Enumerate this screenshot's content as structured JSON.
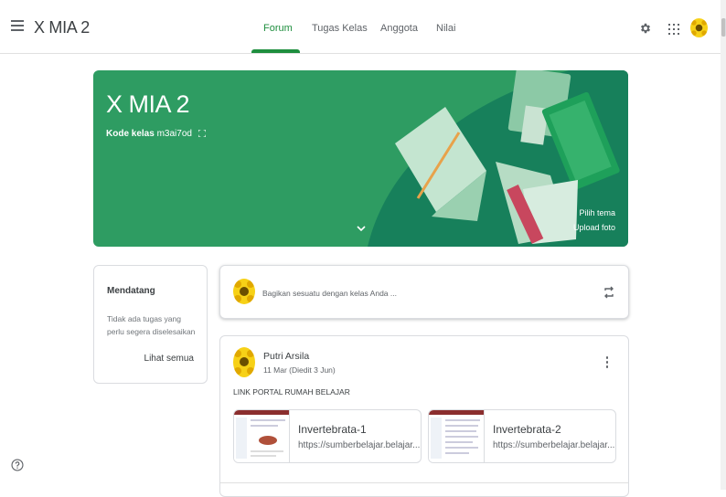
{
  "header": {
    "class_name": "X MIA 2",
    "tabs": [
      {
        "label": "Forum",
        "active": true
      },
      {
        "label": "Tugas Kelas",
        "active": false
      },
      {
        "label": "Anggota",
        "active": false
      },
      {
        "label": "Nilai",
        "active": false
      }
    ],
    "icons": [
      "menu-icon",
      "gear-icon",
      "apps-grid-icon",
      "account-avatar"
    ]
  },
  "banner": {
    "title": "X MIA 2",
    "code_label": "Kode kelas",
    "code_value": "m3ai7od",
    "select_theme": "Pilih tema",
    "upload_photo": "Upload foto",
    "color": "#2e9c62"
  },
  "upcoming": {
    "title": "Mendatang",
    "empty_text": "Tidak ada tugas yang perlu segera diselesaikan",
    "see_all": "Lihat semua"
  },
  "share": {
    "placeholder": "Bagikan sesuatu dengan kelas Anda ..."
  },
  "post": {
    "author": "Putri Arsila",
    "date": "11 Mar (Diedit 3 Jun)",
    "text": "LINK PORTAL RUMAH BELAJAR",
    "attachments": [
      {
        "title": "Invertebrata-1",
        "url": "https://sumberbelajar.belajar..."
      },
      {
        "title": "Invertebrata-2",
        "url": "https://sumberbelajar.belajar..."
      }
    ]
  },
  "colors": {
    "accent": "#1e8e3e",
    "banner": "#2e9c62"
  }
}
